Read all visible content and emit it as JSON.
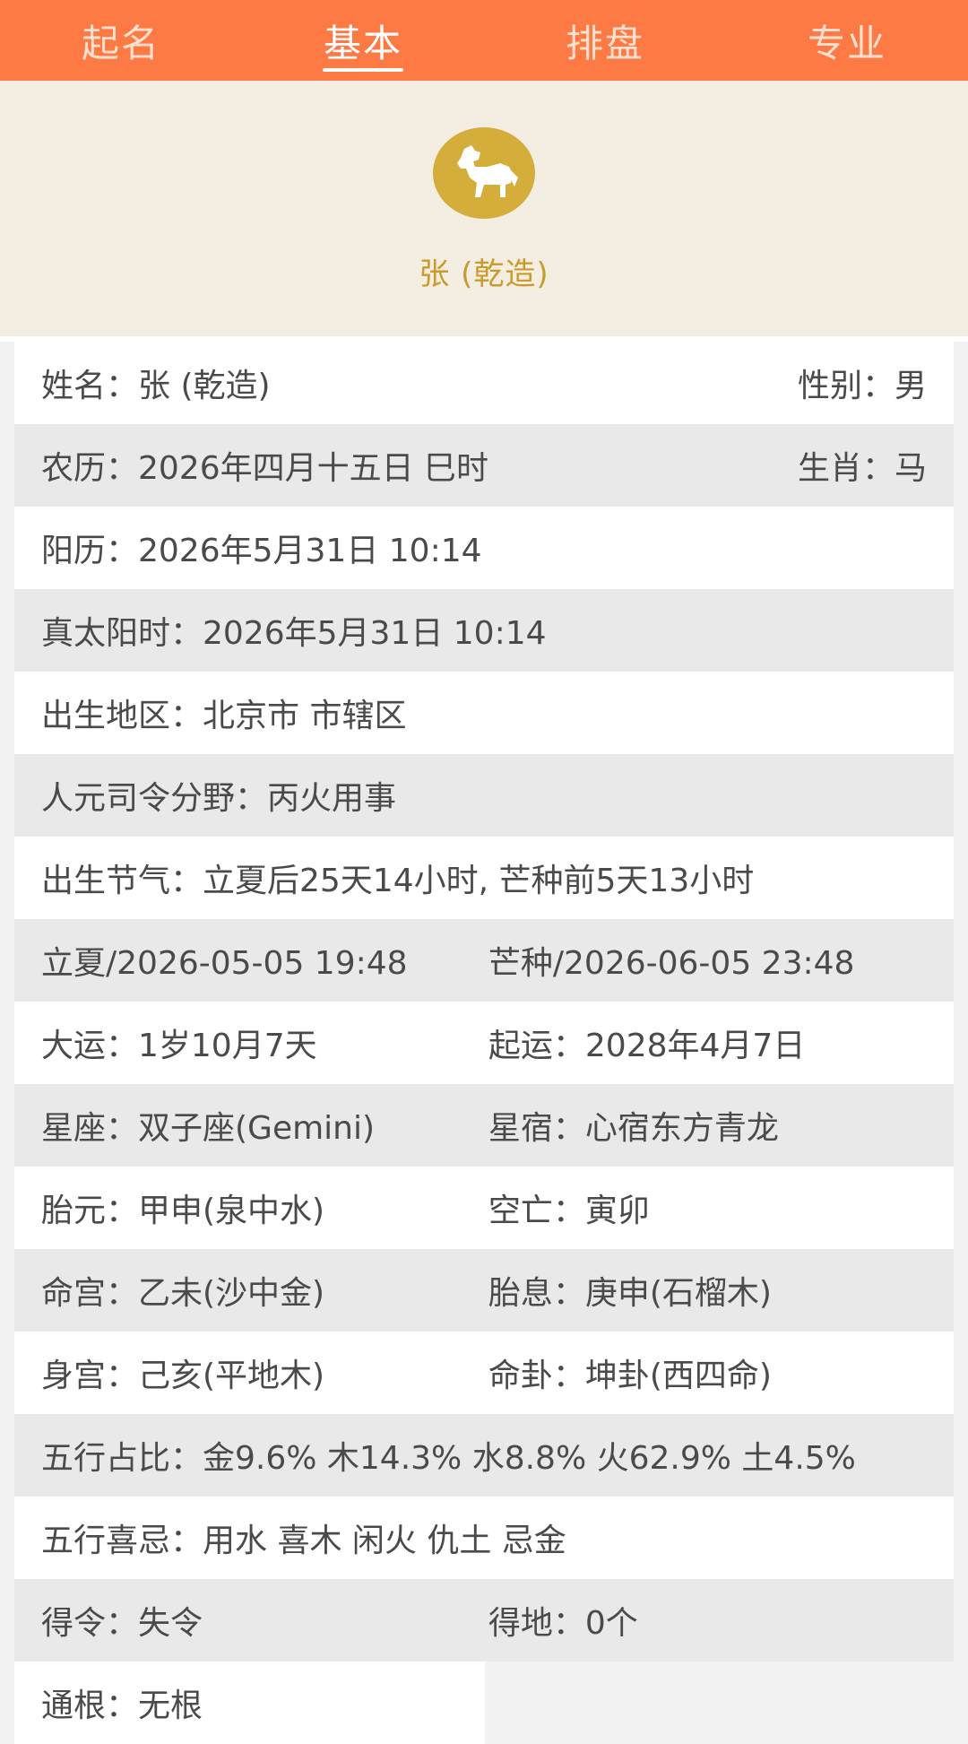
{
  "tabs": [
    {
      "label": "起名",
      "active": false
    },
    {
      "label": "基本",
      "active": true
    },
    {
      "label": "排盘",
      "active": false
    },
    {
      "label": "专业",
      "active": false
    }
  ],
  "hero": {
    "icon": "horse-zodiac-icon",
    "name": "张 (乾造)"
  },
  "colors": {
    "tab_bar": "#fd7a45",
    "hero_bg": "#f3ede2",
    "badge": "#d4ad3a",
    "hero_name": "#c89b2a",
    "row_gray": "#e9e9e9"
  },
  "info": {
    "name": "姓名：张 (乾造)",
    "gender": "性别：男",
    "lunar": "农历：2026年四月十五日 巳时",
    "zodiac": "生肖：马",
    "solar": "阳历：2026年5月31日 10:14",
    "true_solar": "真太阳时：2026年5月31日 10:14",
    "birthplace": "出生地区：北京市 市辖区",
    "renyuan": "人元司令分野：丙火用事",
    "jieqi": "出生节气：立夏后25天14小时, 芒种前5天13小时",
    "jieqi_prev": "立夏/2026-05-05 19:48",
    "jieqi_next": "芒种/2026-06-05 23:48",
    "dayun": "大运：1岁10月7天",
    "qiyun": "起运：2028年4月7日",
    "xingzuo": "星座：双子座(Gemini)",
    "xingxiu": "星宿：心宿东方青龙",
    "taiyuan": "胎元：甲申(泉中水)",
    "kongwang": "空亡：寅卯",
    "minggong": "命宫：乙未(沙中金)",
    "taixi": "胎息：庚申(石榴木)",
    "shengong": "身宫：己亥(平地木)",
    "minggua": "命卦：坤卦(西四命)",
    "wuxing_ratio": "五行占比：金9.6% 木14.3% 水8.8% 火62.9% 土4.5%",
    "wuxing_xiji": "五行喜忌：用水 喜木 闲火 仇土 忌金",
    "deling": "得令：失令",
    "dedi": "得地：0个",
    "tonggen": "通根：无根"
  }
}
